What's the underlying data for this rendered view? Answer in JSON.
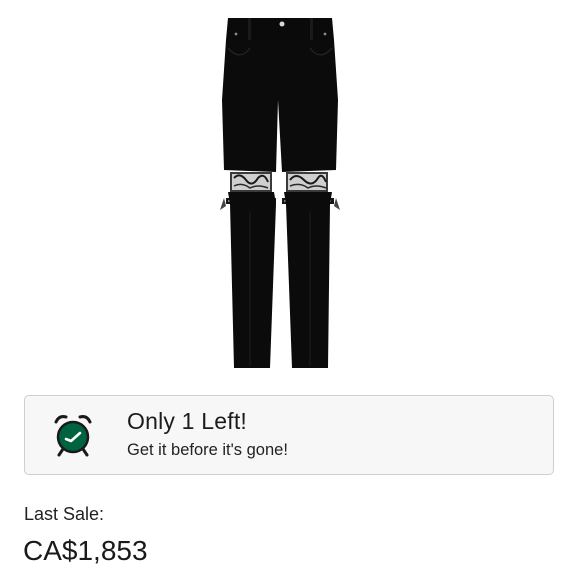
{
  "product": {
    "image_icon": "black-zip-knee-jeans"
  },
  "stock_banner": {
    "icon": "alarm-clock-icon",
    "title": "Only 1 Left!",
    "subtitle": "Get it before it's gone!",
    "accent_color": "#006340",
    "background_color": "#f7f7f7",
    "border_color": "#cfcfcf"
  },
  "last_sale": {
    "label": "Last Sale:",
    "price": "CA$1,853"
  }
}
